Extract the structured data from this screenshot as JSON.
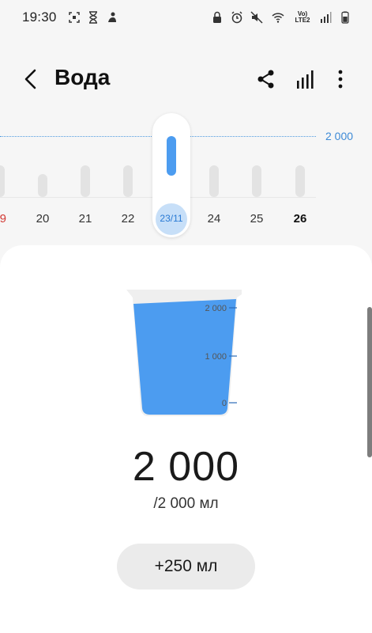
{
  "status_bar": {
    "time": "19:30",
    "network_label": "Vo) LTE2"
  },
  "header": {
    "title": "Вода"
  },
  "day_strip": {
    "goal_label": "2 000",
    "days": [
      {
        "label": "9",
        "style": "red",
        "intake_fraction": 0.55
      },
      {
        "label": "20",
        "style": "normal",
        "intake_fraction": 0.4
      },
      {
        "label": "21",
        "style": "normal",
        "intake_fraction": 0.55
      },
      {
        "label": "22",
        "style": "normal",
        "intake_fraction": 0.55
      },
      {
        "label": "23/11",
        "style": "selected",
        "intake_fraction": 1.0
      },
      {
        "label": "24",
        "style": "normal",
        "intake_fraction": 0.55
      },
      {
        "label": "25",
        "style": "normal",
        "intake_fraction": 0.55
      },
      {
        "label": "26",
        "style": "today",
        "intake_fraction": 0.55
      }
    ]
  },
  "glass": {
    "scale_labels": [
      "2 000",
      "1 000",
      "0"
    ],
    "fill_fraction": 1.0,
    "water_color": "#4c9cf0"
  },
  "intake": {
    "value": "2 000",
    "goal_text": "/2 000 мл"
  },
  "add_button": {
    "label": "+250 мл"
  },
  "colors": {
    "accent": "#4c9cf0",
    "goal_line": "#3d8ad6",
    "weekend": "#d23a35"
  }
}
